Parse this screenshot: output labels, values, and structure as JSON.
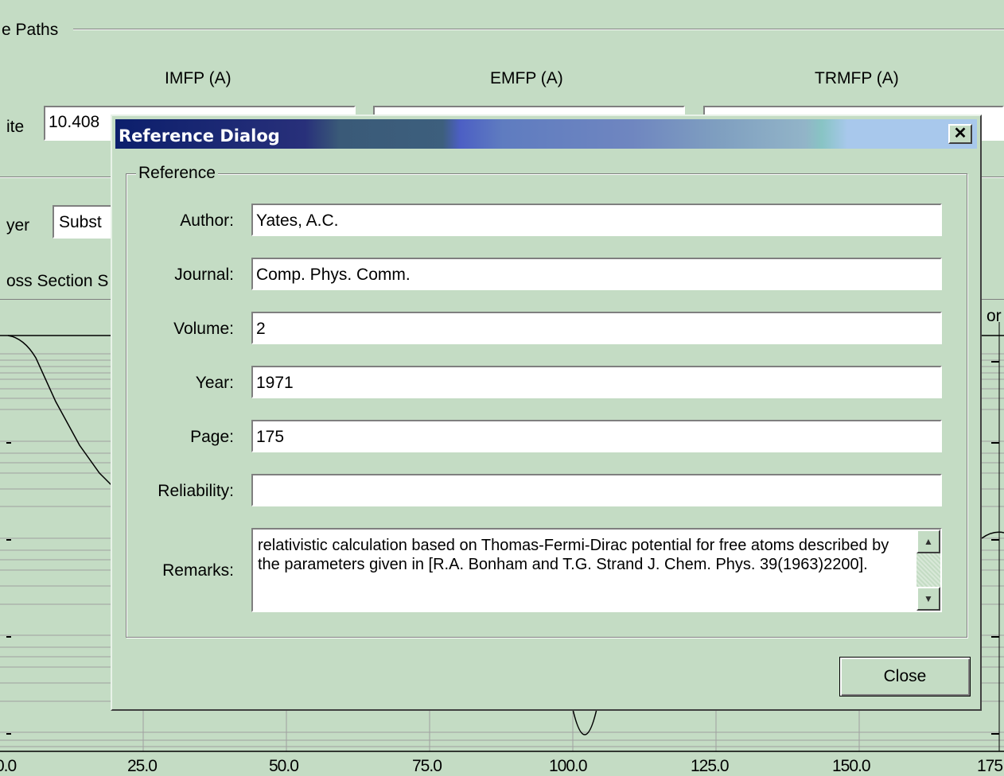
{
  "background": {
    "group_label": "e Paths",
    "columns": [
      "IMFP (A)",
      "EMFP (A)",
      "TRMFP (A)"
    ],
    "row_label": "ite",
    "imfp_value": "10.408",
    "layer_label": "yer",
    "layer_value": "Subst",
    "tab_label": "oss Section S",
    "right_fragment": "or",
    "x_ticks": [
      "0.0",
      "25.0",
      "50.0",
      "75.0",
      "100.0",
      "125.0",
      "150.0",
      "175"
    ]
  },
  "dialog": {
    "title": "Reference Dialog",
    "group_label": "Reference",
    "fields": [
      {
        "label": "Author:",
        "value": "Yates, A.C."
      },
      {
        "label": "Journal:",
        "value": "Comp. Phys. Comm."
      },
      {
        "label": "Volume:",
        "value": "2"
      },
      {
        "label": "Year:",
        "value": "1971"
      },
      {
        "label": "Page:",
        "value": "175"
      },
      {
        "label": "Reliability:",
        "value": ""
      }
    ],
    "remarks_label": "Remarks:",
    "remarks": "relativistic calculation based on Thomas-Fermi-Dirac potential for free atoms described by the parameters given in [R.A. Bonham and T.G. Strand J. Chem. Phys. 39(1963)2200].",
    "close_label": "Close",
    "close_icon": "close-x-icon",
    "scroll_up_icon": "arrow-up-icon",
    "scroll_down_icon": "arrow-down-icon"
  }
}
